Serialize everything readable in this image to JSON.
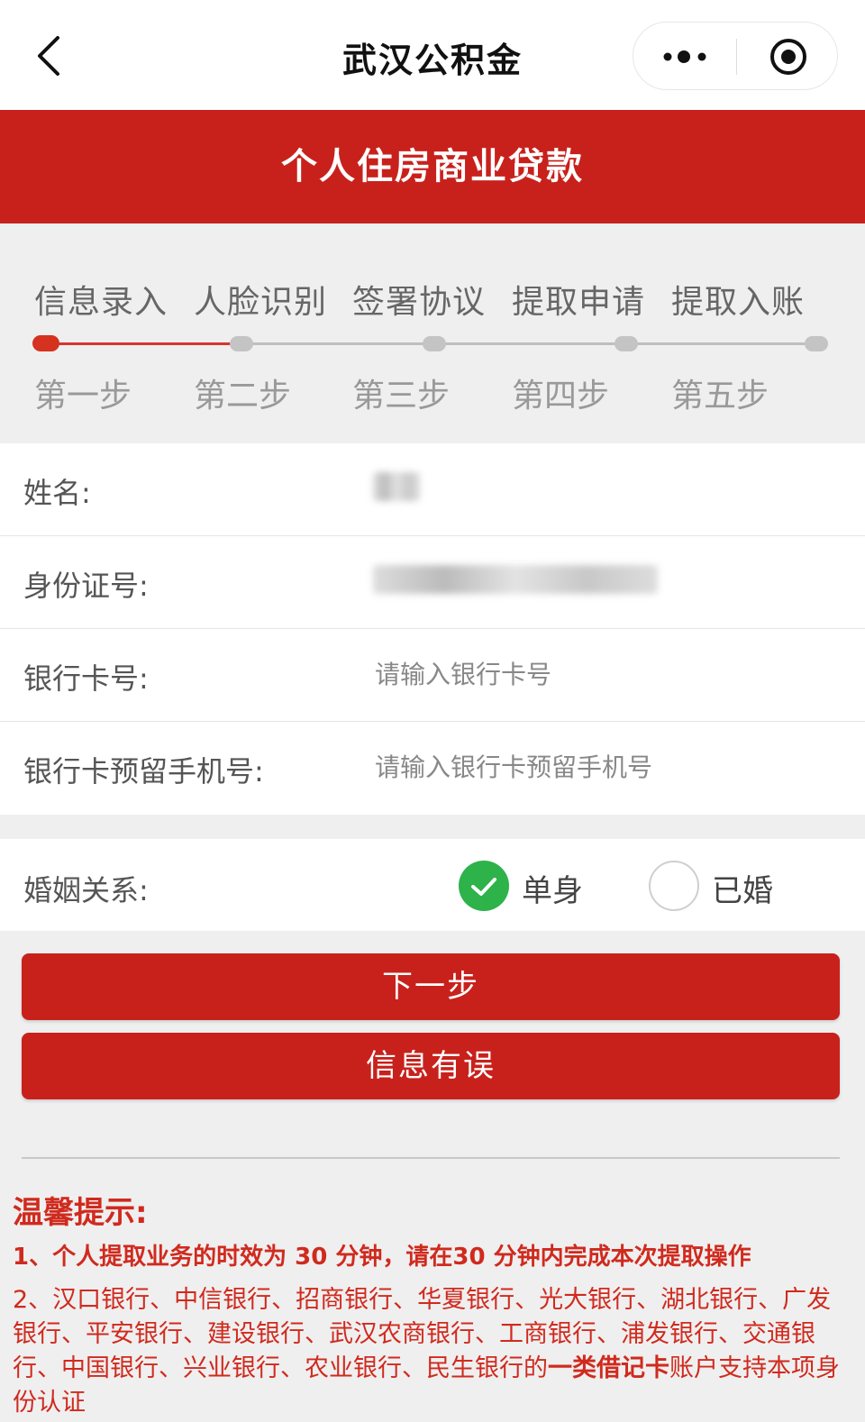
{
  "nav": {
    "title": "武汉公积金"
  },
  "banner": {
    "title": "个人住房商业贷款"
  },
  "steps": [
    {
      "label": "信息录入",
      "sub": "第一步"
    },
    {
      "label": "人脸识别",
      "sub": "第二步"
    },
    {
      "label": "签署协议",
      "sub": "第三步"
    },
    {
      "label": "提取申请",
      "sub": "第四步"
    },
    {
      "label": "提取入账",
      "sub": "第五步"
    }
  ],
  "current_step": 1,
  "form": {
    "name_label": "姓名:",
    "id_label": "身份证号:",
    "card_label": "银行卡号:",
    "card_placeholder": "请输入银行卡号",
    "phone_label": "银行卡预留手机号:",
    "phone_placeholder": "请输入银行卡预留手机号"
  },
  "marriage": {
    "label": "婚姻关系:",
    "options": [
      "单身",
      "已婚"
    ],
    "selected": "单身"
  },
  "buttons": {
    "next": "下一步",
    "error": "信息有误"
  },
  "tips": {
    "title": "温馨提示:",
    "line1": "1、个人提取业务的时效为 30 分钟，请在30 分钟内完成本次提取操作",
    "line2_a": "2、汉口银行、中信银行、招商银行、华夏银行、光大银行、湖北银行、广发银行、平安银行、建设银行、武汉农商银行、工商银行、浦发银行、交通银行、中国银行、兴业银行、农业银行、民生银行的",
    "line2_bold": "一类借记卡",
    "line2_b": "账户支持本项身份认证"
  },
  "colors": {
    "brand_red": "#c8211c",
    "check_green": "#2eb24a"
  }
}
